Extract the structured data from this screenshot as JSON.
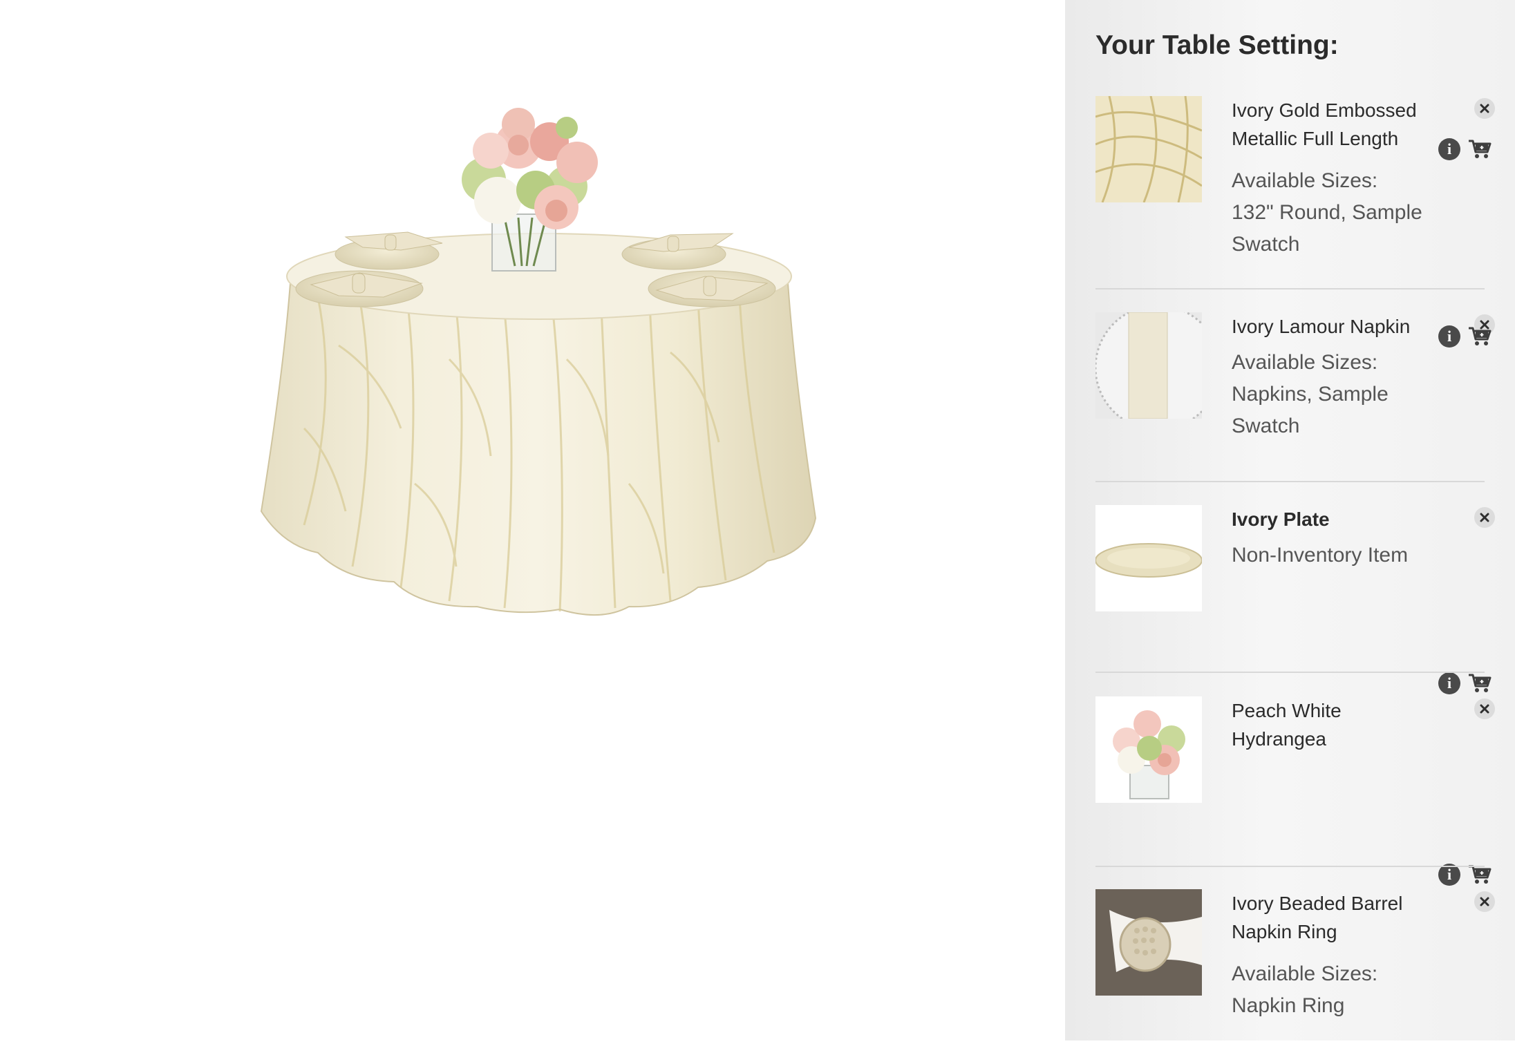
{
  "panel": {
    "title": "Your Table Setting:",
    "items": [
      {
        "name": "Ivory Gold Embossed Metallic Full Length",
        "bold": false,
        "meta_label": "Available Sizes:",
        "meta_value": "132\" Round, Sample Swatch",
        "thumb_icon": "tablecloth-swatch-image",
        "has_actions": true
      },
      {
        "name": "Ivory Lamour Napkin",
        "bold": false,
        "meta_label": "Available Sizes:",
        "meta_value": "Napkins, Sample Swatch",
        "thumb_icon": "napkin-image",
        "has_actions": true
      },
      {
        "name": "Ivory Plate",
        "bold": true,
        "meta_label": "Non-Inventory Item",
        "meta_value": "",
        "thumb_icon": "plate-image",
        "has_actions": false
      },
      {
        "name": "Peach White Hydrangea",
        "bold": false,
        "meta_label": "",
        "meta_value": "",
        "thumb_icon": "centerpiece-image",
        "has_actions": true
      },
      {
        "name": "Ivory Beaded Barrel Napkin Ring",
        "bold": false,
        "meta_label": "Available Sizes:",
        "meta_value": "Napkin Ring",
        "thumb_icon": "napkin-ring-image",
        "has_actions": true
      }
    ],
    "icons": {
      "remove": "close-circle-icon",
      "info": "info-icon",
      "cart": "add-to-cart-icon"
    },
    "info_glyph": "i"
  },
  "colors": {
    "panel_bg": "#f1f1f1",
    "text_dark": "#2b2b2b",
    "text_meta": "#555555",
    "tablecloth": "#f1ebd3",
    "tablecloth_pattern": "#d9cc98"
  }
}
